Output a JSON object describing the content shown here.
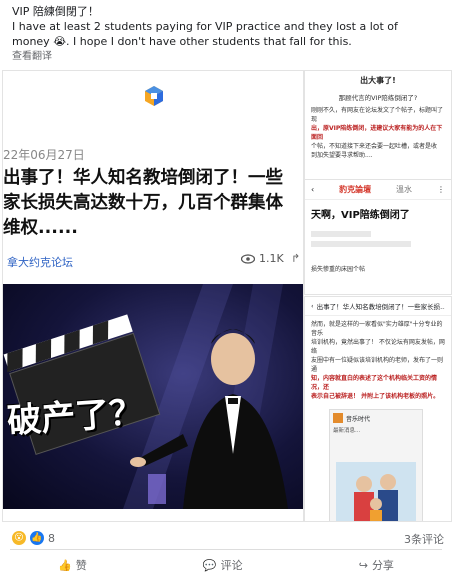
{
  "post": {
    "text": "VIP 陪練倒閉了！\nI have at least 2 students paying for VIP practice and they lost a lot of money 😭. I hope I don't have other students that fall for this.",
    "translate_label": "查看翻译"
  },
  "article": {
    "date": "22年06月27日",
    "headline_1": "出事了！华人知名教培倒闭了！一些",
    "headline_2": "家长损失高达数十万，几百个群集体",
    "headline_3": "维权......",
    "source": "拿大约克论坛",
    "views": "1.1K",
    "banner_text": "破产了？"
  },
  "right_panels": {
    "p1_title": "出大事了!",
    "p1_sub": "那顾代言的VIP陪练倒闭了?",
    "p1_body_1": "刚刚不久，有网友在论坛发文了个帖子，标题叫了现",
    "p1_body_2": "出，原VIP陪练倒闭，进建议大家有能为的人在下面回",
    "p1_body_3": "个帖，不知道接下来还会要一起吐槽，或者是收",
    "p1_body_4": "到加失望要寻求帮助....",
    "p2_brand": "豹克論壇",
    "p2_author": "溫水",
    "p2_title": "天啊，VIP陪练倒闭了",
    "p2_footer": "损失惨重的床园个帖",
    "p3_header": "出事了！华人知名教培倒闭了！一些家长损...",
    "p3_body_1": "然而，就是这样的一家看似\"实力雄厚\"十分专业的音乐",
    "p3_body_2": "培训机构，竟然出事了！ 不仅论坛有网友发帖，网络",
    "p3_body_3": "友圈中有一位疑似该培训机构的老师，发布了一则通",
    "p3_body_4": "知，内容就直白的表述了这个机构临关工资的情况，还",
    "p3_body_5": "表示自己被辞退！ 并附上了该机构老板的照片。",
    "p3_chat_name": "音乐时代",
    "p3_chat_text": "最新消息..."
  },
  "footer": {
    "reaction_count": "8",
    "comment_count": "3条评论",
    "like": "赞",
    "comment": "评论",
    "share": "分享"
  }
}
